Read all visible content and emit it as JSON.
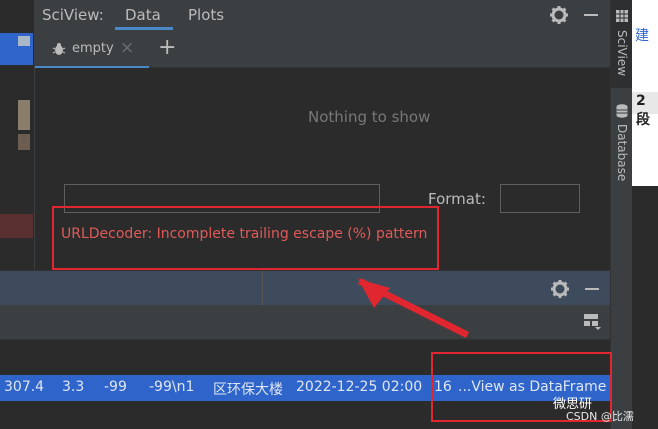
{
  "sciview": {
    "title": "SciView:",
    "tabs": [
      {
        "label": "Data"
      },
      {
        "label": "Plots"
      }
    ],
    "subtab": {
      "label": "empty",
      "close": "×"
    },
    "add_tab": "+",
    "empty_message": "Nothing to show",
    "format_label": "Format:",
    "filter_value": "",
    "format_value": "",
    "error_message": "URLDecoder: Incomplete trailing escape (%) pattern"
  },
  "tool_strip": {
    "sciview": "SciView",
    "database": "Database"
  },
  "far_right": {
    "char1": "建",
    "char2": "2 段"
  },
  "data_row": {
    "cells": [
      "307.4",
      "3.3",
      "-99",
      "-99\\n1",
      "区环保大楼",
      "2022-12-25 02:00",
      "16",
      "...View as DataFrame"
    ]
  },
  "watermark": {
    "brand": "微思研",
    "sub": "CSDN @比濡"
  },
  "colors": {
    "accent": "#4a88c7",
    "error": "#e05a5a",
    "annotation": "#e0262e",
    "selected_row": "#2f65ca"
  },
  "icons": [
    "gear-icon",
    "minimize-icon",
    "bug-icon",
    "close-icon",
    "add-icon",
    "table-icon",
    "database-icon",
    "layout-icon"
  ]
}
